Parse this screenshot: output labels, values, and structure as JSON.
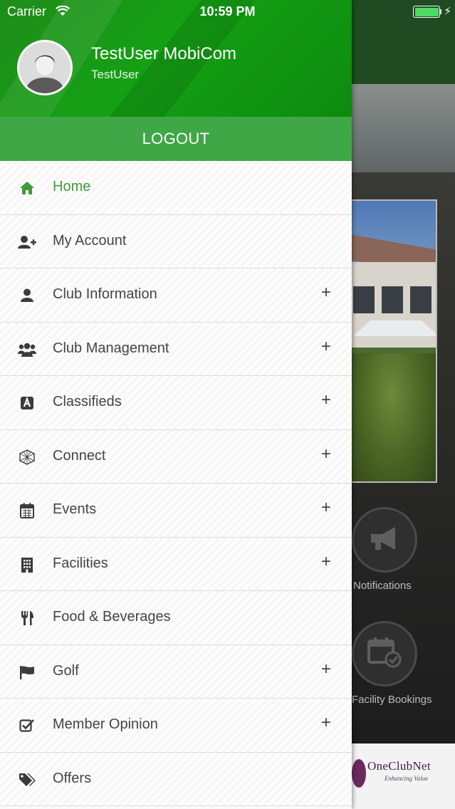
{
  "status_bar": {
    "carrier": "Carrier",
    "time": "10:59 PM",
    "battery_color": "#4cd964"
  },
  "drawer": {
    "user": {
      "name": "TestUser MobiCom",
      "handle": "TestUser"
    },
    "logout_label": "LOGOUT",
    "theme": {
      "header_green": "#14a014",
      "logout_green": "#3fa745",
      "active_green": "#3f9a3b"
    },
    "items": [
      {
        "label": "Home",
        "icon": "home-icon",
        "expandable": false,
        "active": true
      },
      {
        "label": "My Account",
        "icon": "user-add-icon",
        "expandable": false,
        "active": false
      },
      {
        "label": "Club Information",
        "icon": "user-icon",
        "expandable": true,
        "active": false
      },
      {
        "label": "Club Management",
        "icon": "users-group-icon",
        "expandable": true,
        "active": false
      },
      {
        "label": "Classifieds",
        "icon": "classifieds-icon",
        "expandable": true,
        "active": false
      },
      {
        "label": "Connect",
        "icon": "connect-icon",
        "expandable": true,
        "active": false
      },
      {
        "label": "Events",
        "icon": "calendar-icon",
        "expandable": true,
        "active": false
      },
      {
        "label": "Facilities",
        "icon": "building-icon",
        "expandable": true,
        "active": false
      },
      {
        "label": "Food & Beverages",
        "icon": "cutlery-icon",
        "expandable": false,
        "active": false
      },
      {
        "label": "Golf",
        "icon": "flag-icon",
        "expandable": true,
        "active": false
      },
      {
        "label": "Member Opinion",
        "icon": "checkbox-icon",
        "expandable": true,
        "active": false
      },
      {
        "label": "Offers",
        "icon": "tags-icon",
        "expandable": false,
        "active": false
      }
    ],
    "expand_symbol": "+"
  },
  "background_app": {
    "tiles": [
      {
        "label": "Notifications",
        "icon": "megaphone-icon"
      },
      {
        "label": "Facility Bookings",
        "icon": "calendar-check-icon"
      }
    ],
    "footer_logo": {
      "name": "OneClubNet",
      "tagline": "Enhancing Value"
    }
  }
}
